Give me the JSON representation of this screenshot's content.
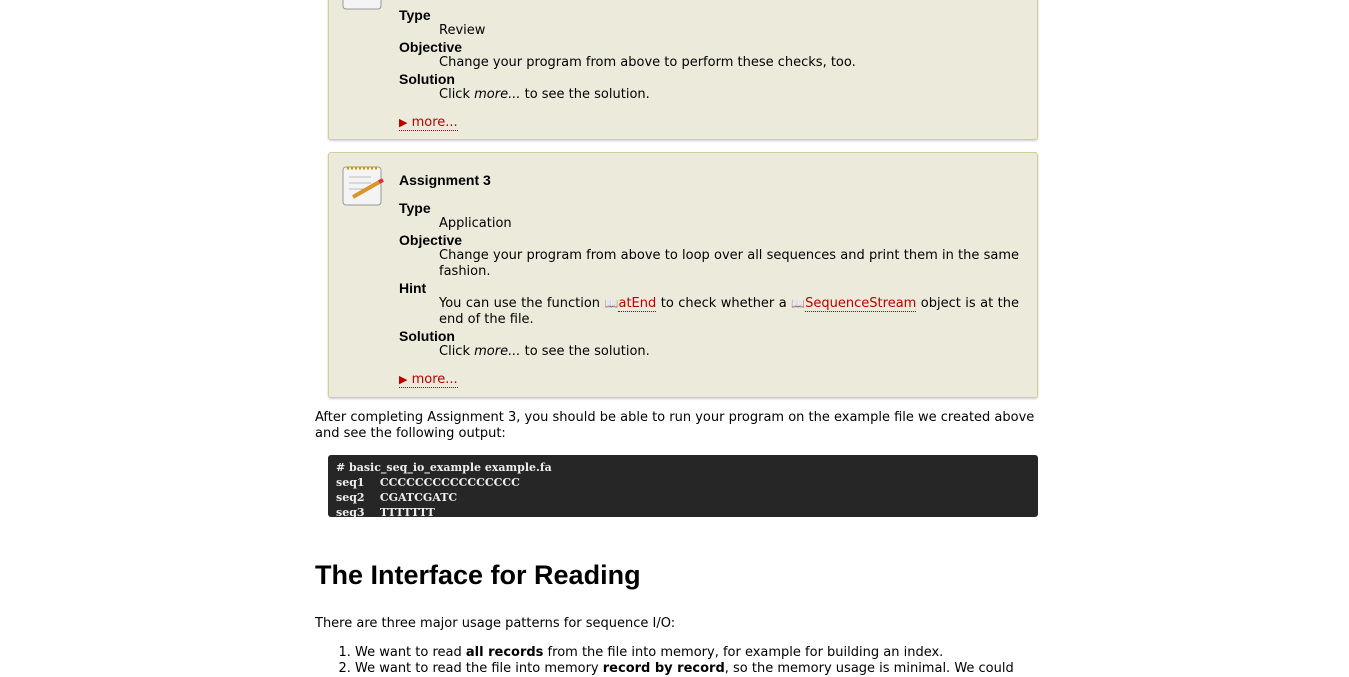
{
  "assignment2": {
    "type_label": "Type",
    "type": "Review",
    "objective_label": "Objective",
    "objective": "Change your program from above to perform these checks, too.",
    "solution_label": "Solution",
    "solution_pre": "Click ",
    "solution_em": "more...",
    "solution_post": " to see the solution.",
    "more": "more..."
  },
  "assignment3": {
    "title": "Assignment 3",
    "type_label": "Type",
    "type": "Application",
    "objective_label": "Objective",
    "objective": "Change your program from above to loop over all sequences and print them in the same fashion.",
    "hint_label": "Hint",
    "hint_1": "You can use the function ",
    "hint_link1": "atEnd",
    "hint_2": " to check whether a ",
    "hint_link2": "SequenceStream",
    "hint_3": " object is at the end of the file.",
    "solution_label": "Solution",
    "solution_pre": "Click ",
    "solution_em": "more...",
    "solution_post": " to see the solution.",
    "more": "more..."
  },
  "after_text": "After completing Assignment 3, you should be able to run your program on the example file we created above and see the following output:",
  "code": "# basic_seq_io_example example.fa\nseq1    CCCCCCCCCCCCCCCC\nseq2    CGATCGATC\nseq3    TTTTTTT",
  "heading": "The Interface for Reading",
  "intro": "There are three major usage patterns for sequence I/O:",
  "list": [
    {
      "pre": "We want to read ",
      "bold": "all records",
      "post": " from the file into memory, for example for building an index."
    },
    {
      "pre": "We want to read the file into memory ",
      "bold": "record by record",
      "post": ", so the memory usage is minimal. We could"
    }
  ]
}
